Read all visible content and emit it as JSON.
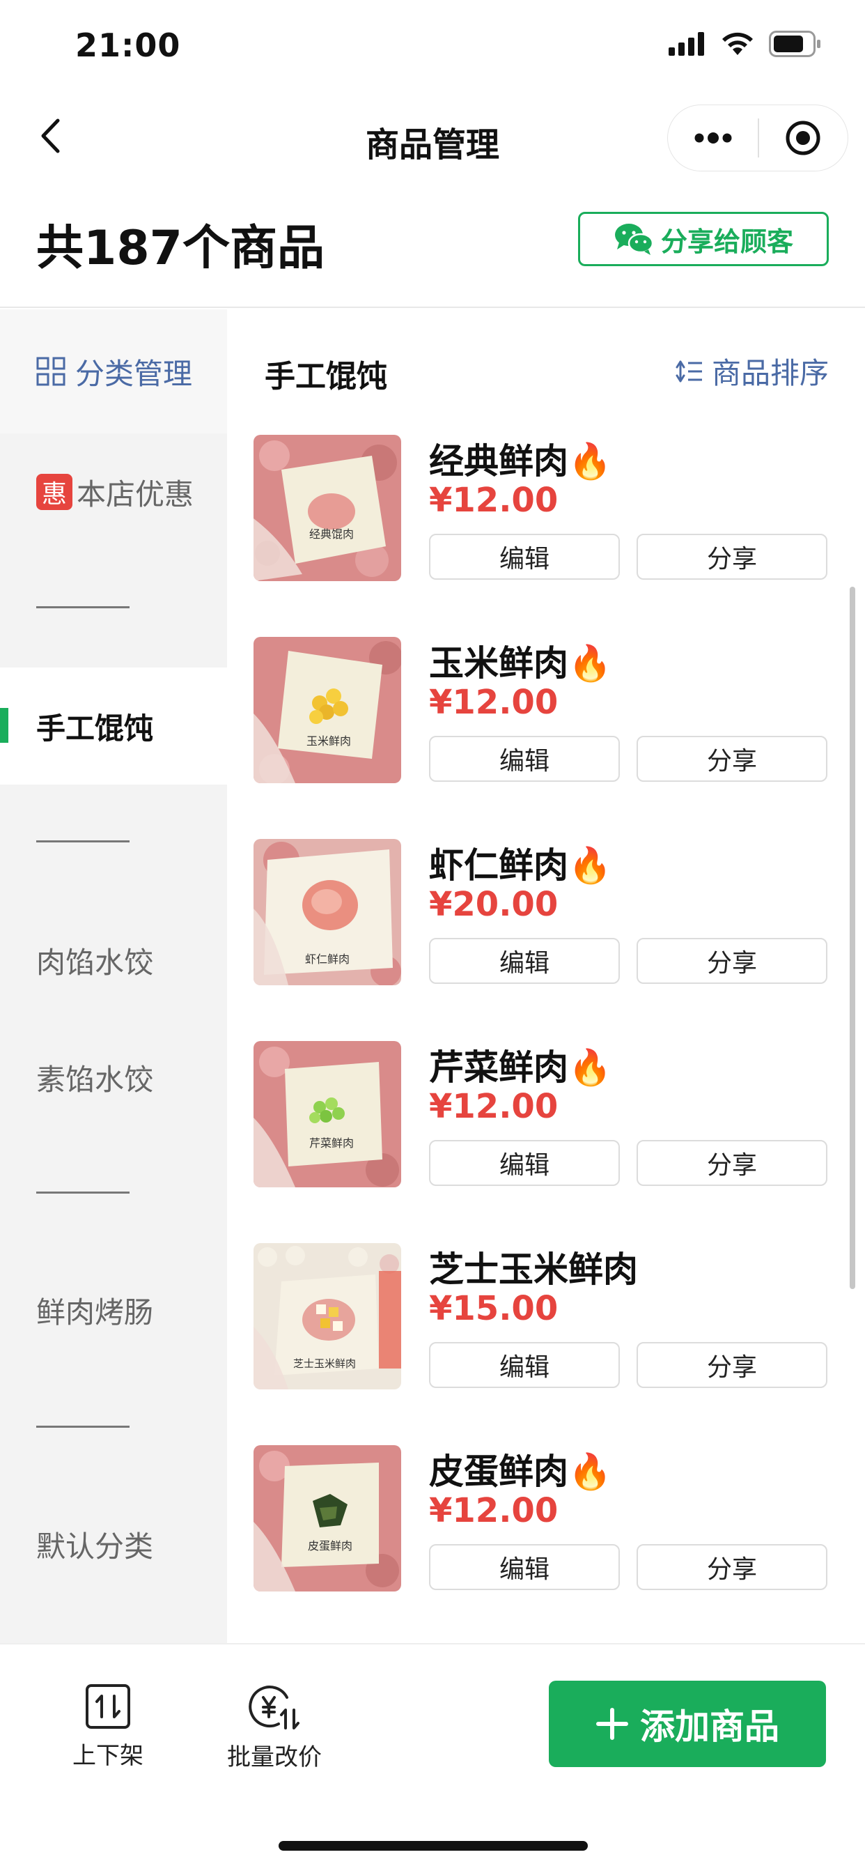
{
  "status_bar": {
    "time": "21:00"
  },
  "nav": {
    "title": "商品管理"
  },
  "header": {
    "total_count": "共187个商品",
    "share_label": "分享给顾客"
  },
  "sidebar": {
    "manage_label": "分类管理",
    "promo_badge": "惠",
    "promo_label": "本店优惠",
    "items": [
      "手工馄饨",
      "肉馅水饺",
      "素馅水饺",
      "鲜肉烤肠",
      "默认分类"
    ]
  },
  "list": {
    "section_title": "手工馄饨",
    "sort_label": "商品排序",
    "products": [
      {
        "name": "经典鲜肉",
        "hot": "🔥",
        "price": "¥12.00",
        "thumb_text": "经典馄肉",
        "edit": "编辑",
        "share": "分享"
      },
      {
        "name": "玉米鲜肉",
        "hot": "🔥",
        "price": "¥12.00",
        "thumb_text": "玉米鲜肉",
        "edit": "编辑",
        "share": "分享"
      },
      {
        "name": "虾仁鲜肉",
        "hot": "🔥",
        "price": "¥20.00",
        "thumb_text": "虾仁鲜肉",
        "edit": "编辑",
        "share": "分享"
      },
      {
        "name": "芹菜鲜肉",
        "hot": "🔥",
        "price": "¥12.00",
        "thumb_text": "芹菜鲜肉",
        "edit": "编辑",
        "share": "分享"
      },
      {
        "name": "芝士玉米鲜肉",
        "hot": "",
        "price": "¥15.00",
        "thumb_text": "芝士玉米鲜肉",
        "edit": "编辑",
        "share": "分享"
      },
      {
        "name": "皮蛋鲜肉",
        "hot": "🔥",
        "price": "¥12.00",
        "thumb_text": "皮蛋鲜肉",
        "edit": "编辑",
        "share": "分享"
      }
    ]
  },
  "bottom_bar": {
    "shelf_label": "上下架",
    "batch_price_label": "批量改价",
    "add_label": "添加商品"
  },
  "colors": {
    "brand_green": "#1aad5b",
    "price_red": "#e6443e",
    "link_blue": "#4a6aa5"
  }
}
